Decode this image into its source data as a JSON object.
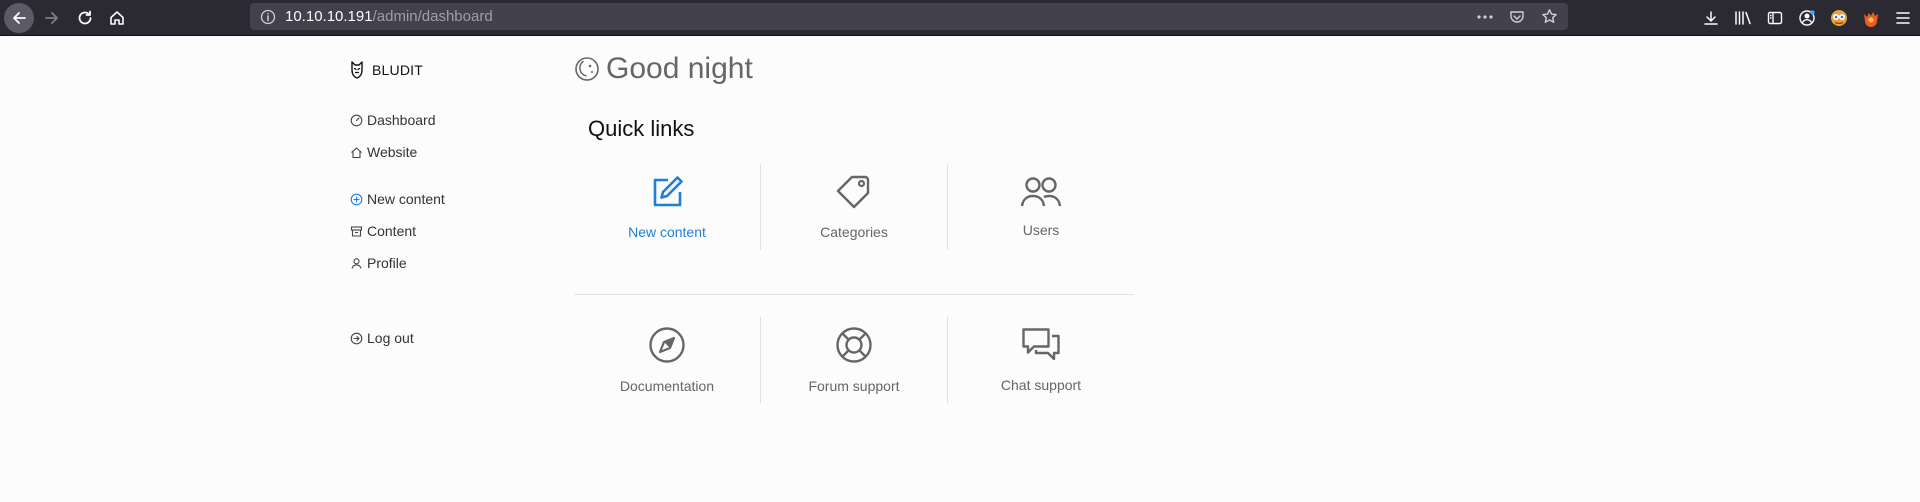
{
  "browser": {
    "url_host": "10.10.10.191",
    "url_path": "/admin/dashboard",
    "icons": [
      "back-arrow-icon",
      "forward-arrow-icon",
      "reload-icon",
      "home-icon",
      "info-icon",
      "more-dots-icon",
      "pocket-icon",
      "star-icon",
      "download-icon",
      "library-icon",
      "sidebar-icon",
      "account-icon",
      "extension-icon",
      "firefox-icon",
      "menu-icon"
    ]
  },
  "sidebar": {
    "brand": "BLUDIT",
    "group1": [
      {
        "label": "Dashboard",
        "icon": "dashboard-icon"
      },
      {
        "label": "Website",
        "icon": "home-icon"
      }
    ],
    "group2": [
      {
        "label": "New content",
        "icon": "plus-circle-icon"
      },
      {
        "label": "Content",
        "icon": "archive-icon"
      },
      {
        "label": "Profile",
        "icon": "person-icon"
      }
    ],
    "group3": [
      {
        "label": "Log out",
        "icon": "logout-icon"
      }
    ]
  },
  "main": {
    "greeting": "Good night",
    "quick_links_title": "Quick links",
    "quick_links": [
      {
        "label": "New content",
        "icon": "edit-icon"
      },
      {
        "label": "Categories",
        "icon": "tag-icon"
      },
      {
        "label": "Users",
        "icon": "users-icon"
      },
      {
        "label": "Documentation",
        "icon": "compass-icon"
      },
      {
        "label": "Forum support",
        "icon": "lifebuoy-icon"
      },
      {
        "label": "Chat support",
        "icon": "chat-icon"
      }
    ]
  },
  "colors": {
    "accent": "#1d7fd8",
    "toolbar": "#2b2a33",
    "urlbar": "#42414d",
    "text_muted": "#666666"
  }
}
